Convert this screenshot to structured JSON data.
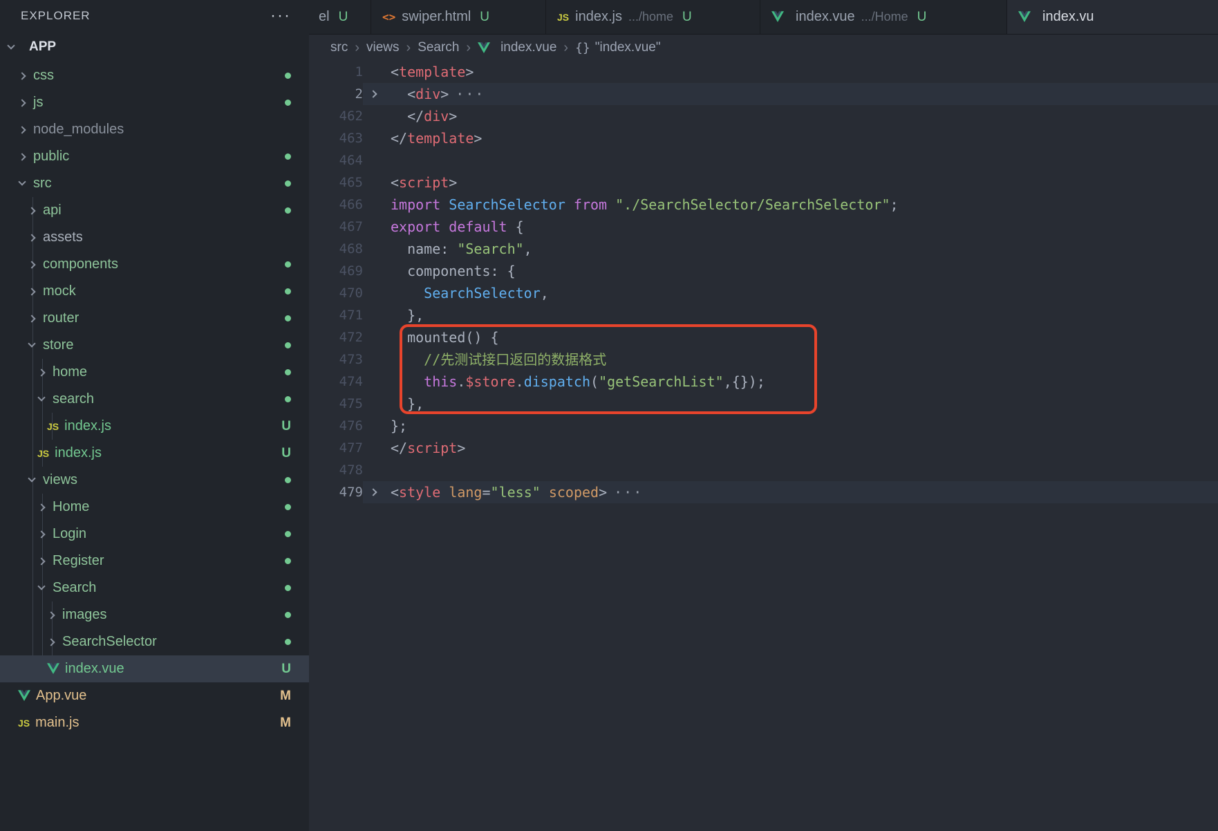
{
  "sidebar": {
    "header": "EXPLORER",
    "menu_icon": "···",
    "section": "APP",
    "tree": [
      {
        "label": "css",
        "depth": 1,
        "kind": "folder",
        "expanded": false,
        "badge": "dot",
        "status": "contains"
      },
      {
        "label": "js",
        "depth": 1,
        "kind": "folder",
        "expanded": false,
        "badge": "dot",
        "status": "contains"
      },
      {
        "label": "node_modules",
        "depth": 1,
        "kind": "folder",
        "expanded": false,
        "badge": "",
        "status": "ignored"
      },
      {
        "label": "public",
        "depth": 1,
        "kind": "folder",
        "expanded": false,
        "badge": "dot",
        "status": "contains"
      },
      {
        "label": "src",
        "depth": 1,
        "kind": "folder",
        "expanded": true,
        "badge": "dot",
        "status": "contains"
      },
      {
        "label": "api",
        "depth": 2,
        "kind": "folder",
        "expanded": false,
        "badge": "dot",
        "status": "contains"
      },
      {
        "label": "assets",
        "depth": 2,
        "kind": "folder",
        "expanded": false,
        "badge": "",
        "status": "none"
      },
      {
        "label": "components",
        "depth": 2,
        "kind": "folder",
        "expanded": false,
        "badge": "dot",
        "status": "contains"
      },
      {
        "label": "mock",
        "depth": 2,
        "kind": "folder",
        "expanded": false,
        "badge": "dot",
        "status": "contains"
      },
      {
        "label": "router",
        "depth": 2,
        "kind": "folder",
        "expanded": false,
        "badge": "dot",
        "status": "contains"
      },
      {
        "label": "store",
        "depth": 2,
        "kind": "folder",
        "expanded": true,
        "badge": "dot",
        "status": "contains"
      },
      {
        "label": "home",
        "depth": 3,
        "kind": "folder",
        "expanded": false,
        "badge": "dot",
        "status": "contains"
      },
      {
        "label": "search",
        "depth": 3,
        "kind": "folder",
        "expanded": true,
        "badge": "dot",
        "status": "contains"
      },
      {
        "label": "index.js",
        "depth": 4,
        "kind": "js",
        "expanded": false,
        "badge": "U",
        "status": "untracked"
      },
      {
        "label": "index.js",
        "depth": 3,
        "kind": "js",
        "expanded": false,
        "badge": "U",
        "status": "untracked"
      },
      {
        "label": "views",
        "depth": 2,
        "kind": "folder",
        "expanded": true,
        "badge": "dot",
        "status": "contains"
      },
      {
        "label": "Home",
        "depth": 3,
        "kind": "folder",
        "expanded": false,
        "badge": "dot",
        "status": "contains"
      },
      {
        "label": "Login",
        "depth": 3,
        "kind": "folder",
        "expanded": false,
        "badge": "dot",
        "status": "contains"
      },
      {
        "label": "Register",
        "depth": 3,
        "kind": "folder",
        "expanded": false,
        "badge": "dot",
        "status": "contains"
      },
      {
        "label": "Search",
        "depth": 3,
        "kind": "folder",
        "expanded": true,
        "badge": "dot",
        "status": "contains"
      },
      {
        "label": "images",
        "depth": 4,
        "kind": "folder",
        "expanded": false,
        "badge": "dot",
        "status": "contains"
      },
      {
        "label": "SearchSelector",
        "depth": 4,
        "kind": "folder",
        "expanded": false,
        "badge": "dot",
        "status": "contains"
      },
      {
        "label": "index.vue",
        "depth": 4,
        "kind": "vue",
        "expanded": false,
        "badge": "U",
        "status": "untracked",
        "selected": true
      },
      {
        "label": "App.vue",
        "depth": 1,
        "kind": "vue",
        "expanded": false,
        "badge": "M",
        "status": "modified"
      },
      {
        "label": "main.js",
        "depth": 1,
        "kind": "js",
        "expanded": false,
        "badge": "M",
        "status": "modified"
      }
    ]
  },
  "tabs": [
    {
      "label": "el",
      "icon": "",
      "dim": "",
      "badge": "U",
      "active": false
    },
    {
      "label": "swiper.html",
      "icon": "html",
      "dim": "",
      "badge": "U",
      "active": false
    },
    {
      "label": "index.js",
      "icon": "js",
      "dim": ".../home",
      "badge": "U",
      "active": false
    },
    {
      "label": "index.vue",
      "icon": "vue",
      "dim": ".../Home",
      "badge": "U",
      "active": false
    },
    {
      "label": "index.vu",
      "icon": "vue",
      "dim": "",
      "badge": "",
      "active": true
    }
  ],
  "breadcrumb": {
    "items": [
      {
        "label": "src",
        "icon": ""
      },
      {
        "label": "views",
        "icon": ""
      },
      {
        "label": "Search",
        "icon": ""
      },
      {
        "label": "index.vue",
        "icon": "vue"
      },
      {
        "label": "\"index.vue\"",
        "icon": "braces"
      }
    ]
  },
  "editor": {
    "lines": [
      {
        "n": "1",
        "fold": false,
        "hl": false,
        "dots": false,
        "tokens": [
          [
            "<",
            "p"
          ],
          [
            "template",
            "t"
          ],
          [
            ">",
            "p"
          ]
        ]
      },
      {
        "n": "2",
        "fold": true,
        "hl": true,
        "dots": true,
        "tokens": [
          [
            "  <",
            "p"
          ],
          [
            "div",
            "t"
          ],
          [
            ">",
            "p"
          ]
        ]
      },
      {
        "n": "462",
        "fold": false,
        "hl": false,
        "dots": false,
        "tokens": [
          [
            "  </",
            "p"
          ],
          [
            "div",
            "t"
          ],
          [
            ">",
            "p"
          ]
        ]
      },
      {
        "n": "463",
        "fold": false,
        "hl": false,
        "dots": false,
        "tokens": [
          [
            "</",
            "p"
          ],
          [
            "template",
            "t"
          ],
          [
            ">",
            "p"
          ]
        ]
      },
      {
        "n": "464",
        "fold": false,
        "hl": false,
        "dots": false,
        "tokens": []
      },
      {
        "n": "465",
        "fold": false,
        "hl": false,
        "dots": false,
        "tokens": [
          [
            "<",
            "p"
          ],
          [
            "script",
            "t"
          ],
          [
            ">",
            "p"
          ]
        ]
      },
      {
        "n": "466",
        "fold": false,
        "hl": false,
        "dots": false,
        "tokens": [
          [
            "import",
            "k"
          ],
          [
            " ",
            "p"
          ],
          [
            "SearchSelector",
            "b"
          ],
          [
            " ",
            "p"
          ],
          [
            "from",
            "k"
          ],
          [
            " ",
            "p"
          ],
          [
            "\"./SearchSelector/SearchSelector\"",
            "s"
          ],
          [
            ";",
            "p"
          ]
        ]
      },
      {
        "n": "467",
        "fold": false,
        "hl": false,
        "dots": false,
        "tokens": [
          [
            "export",
            "k"
          ],
          [
            " ",
            "p"
          ],
          [
            "default",
            "k"
          ],
          [
            " {",
            "p"
          ]
        ]
      },
      {
        "n": "468",
        "fold": false,
        "hl": false,
        "dots": false,
        "tokens": [
          [
            "  name",
            "p"
          ],
          [
            ": ",
            "p"
          ],
          [
            "\"Search\"",
            "s"
          ],
          [
            ",",
            "p"
          ]
        ]
      },
      {
        "n": "469",
        "fold": false,
        "hl": false,
        "dots": false,
        "tokens": [
          [
            "  components",
            "p"
          ],
          [
            ": {",
            "p"
          ]
        ]
      },
      {
        "n": "470",
        "fold": false,
        "hl": false,
        "dots": false,
        "tokens": [
          [
            "    ",
            "p"
          ],
          [
            "SearchSelector",
            "b"
          ],
          [
            ",",
            "p"
          ]
        ]
      },
      {
        "n": "471",
        "fold": false,
        "hl": false,
        "dots": false,
        "tokens": [
          [
            "  },",
            "p"
          ]
        ]
      },
      {
        "n": "472",
        "fold": false,
        "hl": false,
        "dots": false,
        "tokens": [
          [
            "  mounted",
            "p"
          ],
          [
            "() {",
            "p"
          ]
        ]
      },
      {
        "n": "473",
        "fold": false,
        "hl": false,
        "dots": false,
        "tokens": [
          [
            "    ",
            "p"
          ],
          [
            "//先测试接口返回的数据格式",
            "c"
          ]
        ]
      },
      {
        "n": "474",
        "fold": false,
        "hl": false,
        "dots": false,
        "tokens": [
          [
            "    ",
            "p"
          ],
          [
            "this",
            "k"
          ],
          [
            ".",
            "p"
          ],
          [
            "$store",
            "r"
          ],
          [
            ".",
            "p"
          ],
          [
            "dispatch",
            "b"
          ],
          [
            "(",
            "p"
          ],
          [
            "\"getSearchList\"",
            "s"
          ],
          [
            ",{});",
            "p"
          ]
        ]
      },
      {
        "n": "475",
        "fold": false,
        "hl": false,
        "dots": false,
        "tokens": [
          [
            "  },",
            "p"
          ]
        ]
      },
      {
        "n": "476",
        "fold": false,
        "hl": false,
        "dots": false,
        "tokens": [
          [
            "};",
            "p"
          ]
        ]
      },
      {
        "n": "477",
        "fold": false,
        "hl": false,
        "dots": false,
        "tokens": [
          [
            "</",
            "p"
          ],
          [
            "script",
            "t"
          ],
          [
            ">",
            "p"
          ]
        ]
      },
      {
        "n": "478",
        "fold": false,
        "hl": false,
        "dots": false,
        "tokens": []
      },
      {
        "n": "479",
        "fold": true,
        "hl": true,
        "dots": true,
        "tokens": [
          [
            "<",
            "p"
          ],
          [
            "style",
            "t"
          ],
          [
            " ",
            "p"
          ],
          [
            "lang",
            "a"
          ],
          [
            "=",
            "p"
          ],
          [
            "\"less\"",
            "s"
          ],
          [
            " ",
            "p"
          ],
          [
            "scoped",
            "a"
          ],
          [
            ">",
            "p"
          ]
        ]
      }
    ]
  },
  "annotation": {
    "color": "#e8442c"
  }
}
